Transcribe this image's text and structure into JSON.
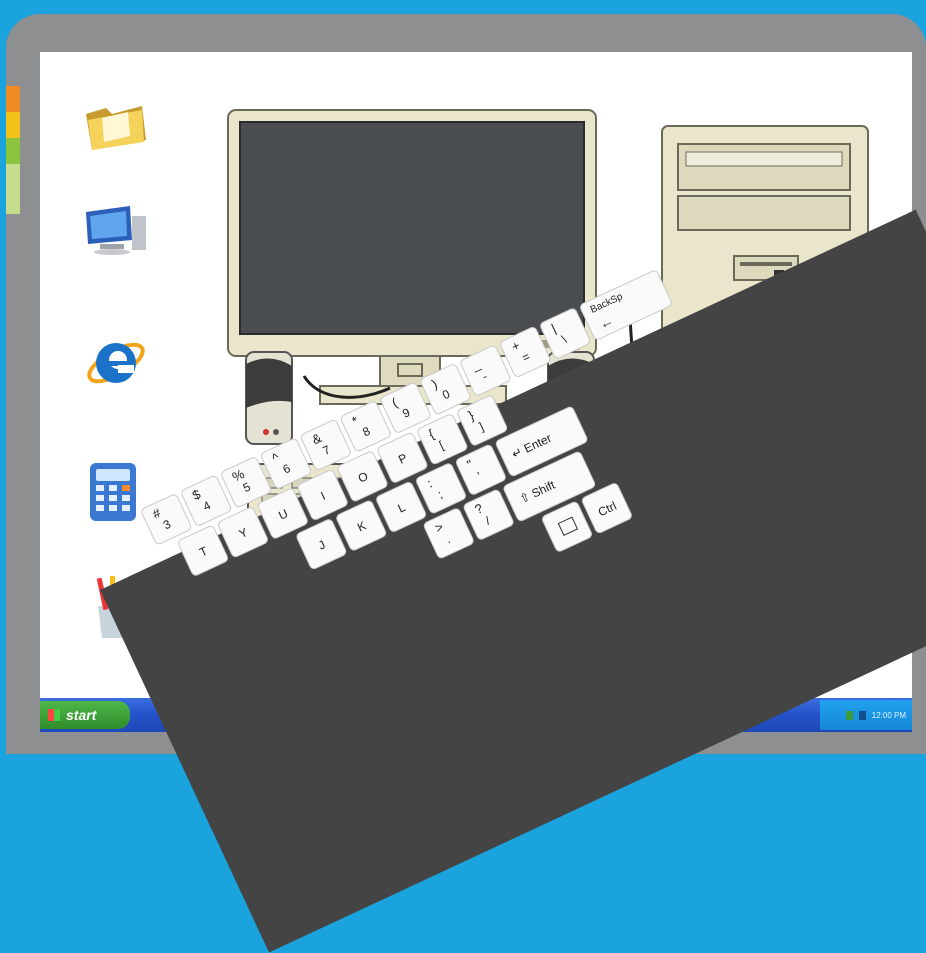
{
  "taskbar": {
    "start_label": "start",
    "clock": "12:00 PM"
  },
  "desktop_icons": [
    {
      "name": "folder-icon"
    },
    {
      "name": "my-computer-icon"
    },
    {
      "name": "internet-explorer-icon"
    },
    {
      "name": "calculator-icon"
    },
    {
      "name": "paint-icon"
    },
    {
      "name": "recycle-bin-icon"
    }
  ],
  "keyboard": {
    "row1": [
      {
        "top": "#",
        "bot": "3"
      },
      {
        "top": "$",
        "bot": "4"
      },
      {
        "top": "%",
        "bot": "5"
      },
      {
        "top": "^",
        "bot": "6"
      },
      {
        "top": "&",
        "bot": "7"
      },
      {
        "top": "*",
        "bot": "8"
      },
      {
        "top": "(",
        "bot": "9"
      },
      {
        "top": ")",
        "bot": "0"
      },
      {
        "top": "_",
        "bot": "-"
      },
      {
        "top": "+",
        "bot": "="
      },
      {
        "top": "|",
        "bot": "\\"
      }
    ],
    "backspace": "BackSp",
    "row2": [
      "T",
      "Y",
      "U",
      "I",
      "O",
      "P"
    ],
    "row2b": [
      {
        "top": "{",
        "bot": "["
      },
      {
        "top": "}",
        "bot": "]"
      }
    ],
    "row3": [
      "J",
      "K",
      "L"
    ],
    "row3b": [
      {
        "top": ":",
        "bot": ";"
      },
      {
        "top": "\"",
        "bot": "'"
      }
    ],
    "enter": "Enter",
    "row4b": [
      {
        "top": ">",
        "bot": "."
      },
      {
        "top": "?",
        "bot": "/"
      }
    ],
    "shift": "Shift",
    "ctrl": "Ctrl"
  }
}
